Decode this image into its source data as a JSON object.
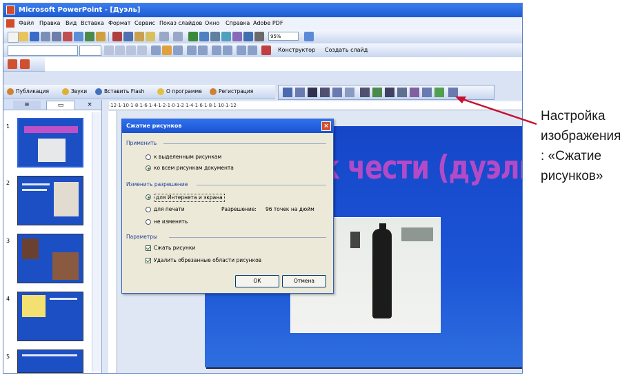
{
  "window": {
    "title": "Microsoft PowerPoint - [Дуэль]"
  },
  "menu": [
    "Файл",
    "Правка",
    "Вид",
    "Вставка",
    "Формат",
    "Сервис",
    "Показ слайдов",
    "Окно",
    "Справка",
    "Adobe PDF"
  ],
  "toolbar": {
    "zoom": "95%",
    "designer_label": "Конструктор",
    "create_slide_label": "Создать слайд"
  },
  "addins_toolbar": [
    "Публикация",
    "Звуки",
    "Вставить Flash",
    "О программе",
    "Регистрация"
  ],
  "slides_pane": {
    "tab_close": "×",
    "slide_numbers": [
      "1",
      "2",
      "3",
      "4",
      "5"
    ]
  },
  "ruler": {
    "h": "·12·1·10·1·8·1·6·1·4·1·2·1·0·1·2·1·4·1·6·1·8·1·10·1·12·"
  },
  "slide": {
    "title": "к чести (дуэль)"
  },
  "dialog": {
    "title": "Сжатие рисунков",
    "group_apply": "Применить",
    "apply_selected": "к выделенным рисункам",
    "apply_all": "ко всем рисункам документа",
    "group_resolution": "Изменить разрешение",
    "res_web": "для Интернета и экрана",
    "res_print": "для печати",
    "res_none": "не изменять",
    "resolution_label": "Разрешение:",
    "resolution_value": "96 точек на дюйм",
    "group_params": "Параметры",
    "compress": "Сжать рисунки",
    "delete_cropped": "Удалить обрезанные области рисунков",
    "ok": "ОК",
    "cancel": "Отмена",
    "close": "×"
  },
  "annotation": {
    "line1": "Настройка",
    "line2": "изображения",
    "line3": ": «Сжатие",
    "line4": "рисунков»"
  },
  "colors": {
    "accent": "#1d4fc4",
    "title_purple": "#b34ac8",
    "arrow": "#c8102e"
  }
}
